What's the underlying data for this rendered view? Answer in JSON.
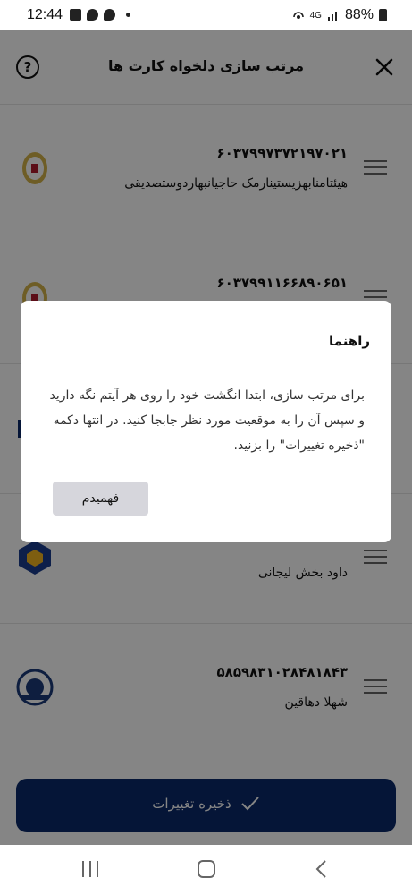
{
  "status_bar": {
    "time": "12:44",
    "network": "4G",
    "battery": "88%",
    "icons": [
      "gallery-icon",
      "chat-icon",
      "chat-icon",
      "dot-icon",
      "hotspot-icon",
      "signal-icon",
      "battery-icon"
    ]
  },
  "header": {
    "title": "مرتب سازی دلخواه کارت ها",
    "help_icon": "?",
    "close_icon": "close-icon"
  },
  "cards": [
    {
      "number": "۶۰۳۷۹۹۷۳۷۲۱۹۷۰۲۱",
      "holder": "هیئتامنابهزیستینارمک حاجیانبهاردوستصدیقی",
      "bank_icon": "bank-melli-logo"
    },
    {
      "number": "۶۰۳۷۹۹۱۱۶۶۸۹۰۶۵۱",
      "holder": "",
      "bank_icon": "bank-melli-logo"
    },
    {
      "number": "",
      "holder": "",
      "bank_icon": "bank-logo"
    },
    {
      "number": "",
      "holder": "داود بخش لیجانی",
      "bank_icon": "bank-maskan-logo"
    },
    {
      "number": "۵۸۵۹۸۳۱۰۲۸۴۸۱۸۴۳",
      "holder": "شهلا دهاقین",
      "bank_icon": "bank-tejarat-logo"
    }
  ],
  "save_button": {
    "label": "ذخیره تغییرات",
    "icon": "check-icon"
  },
  "dialog": {
    "title": "راهنما",
    "body": "برای مرتب سازی، ابتدا انگشت خود را روی هر آیتم نگه دارید و سپس آن را به موقعیت مورد نظر جابجا کنید. در انتها دکمه \"ذخیره تغییرات\" را بزنید.",
    "confirm_label": "فهمیدم"
  },
  "nav": {
    "recents": "recents-icon",
    "home": "home-icon",
    "back": "back-icon"
  },
  "colors": {
    "primary": "#0a2a6a",
    "overlay": "rgba(0,0,0,0.48)",
    "dialog_button": "#d6d6dc"
  }
}
